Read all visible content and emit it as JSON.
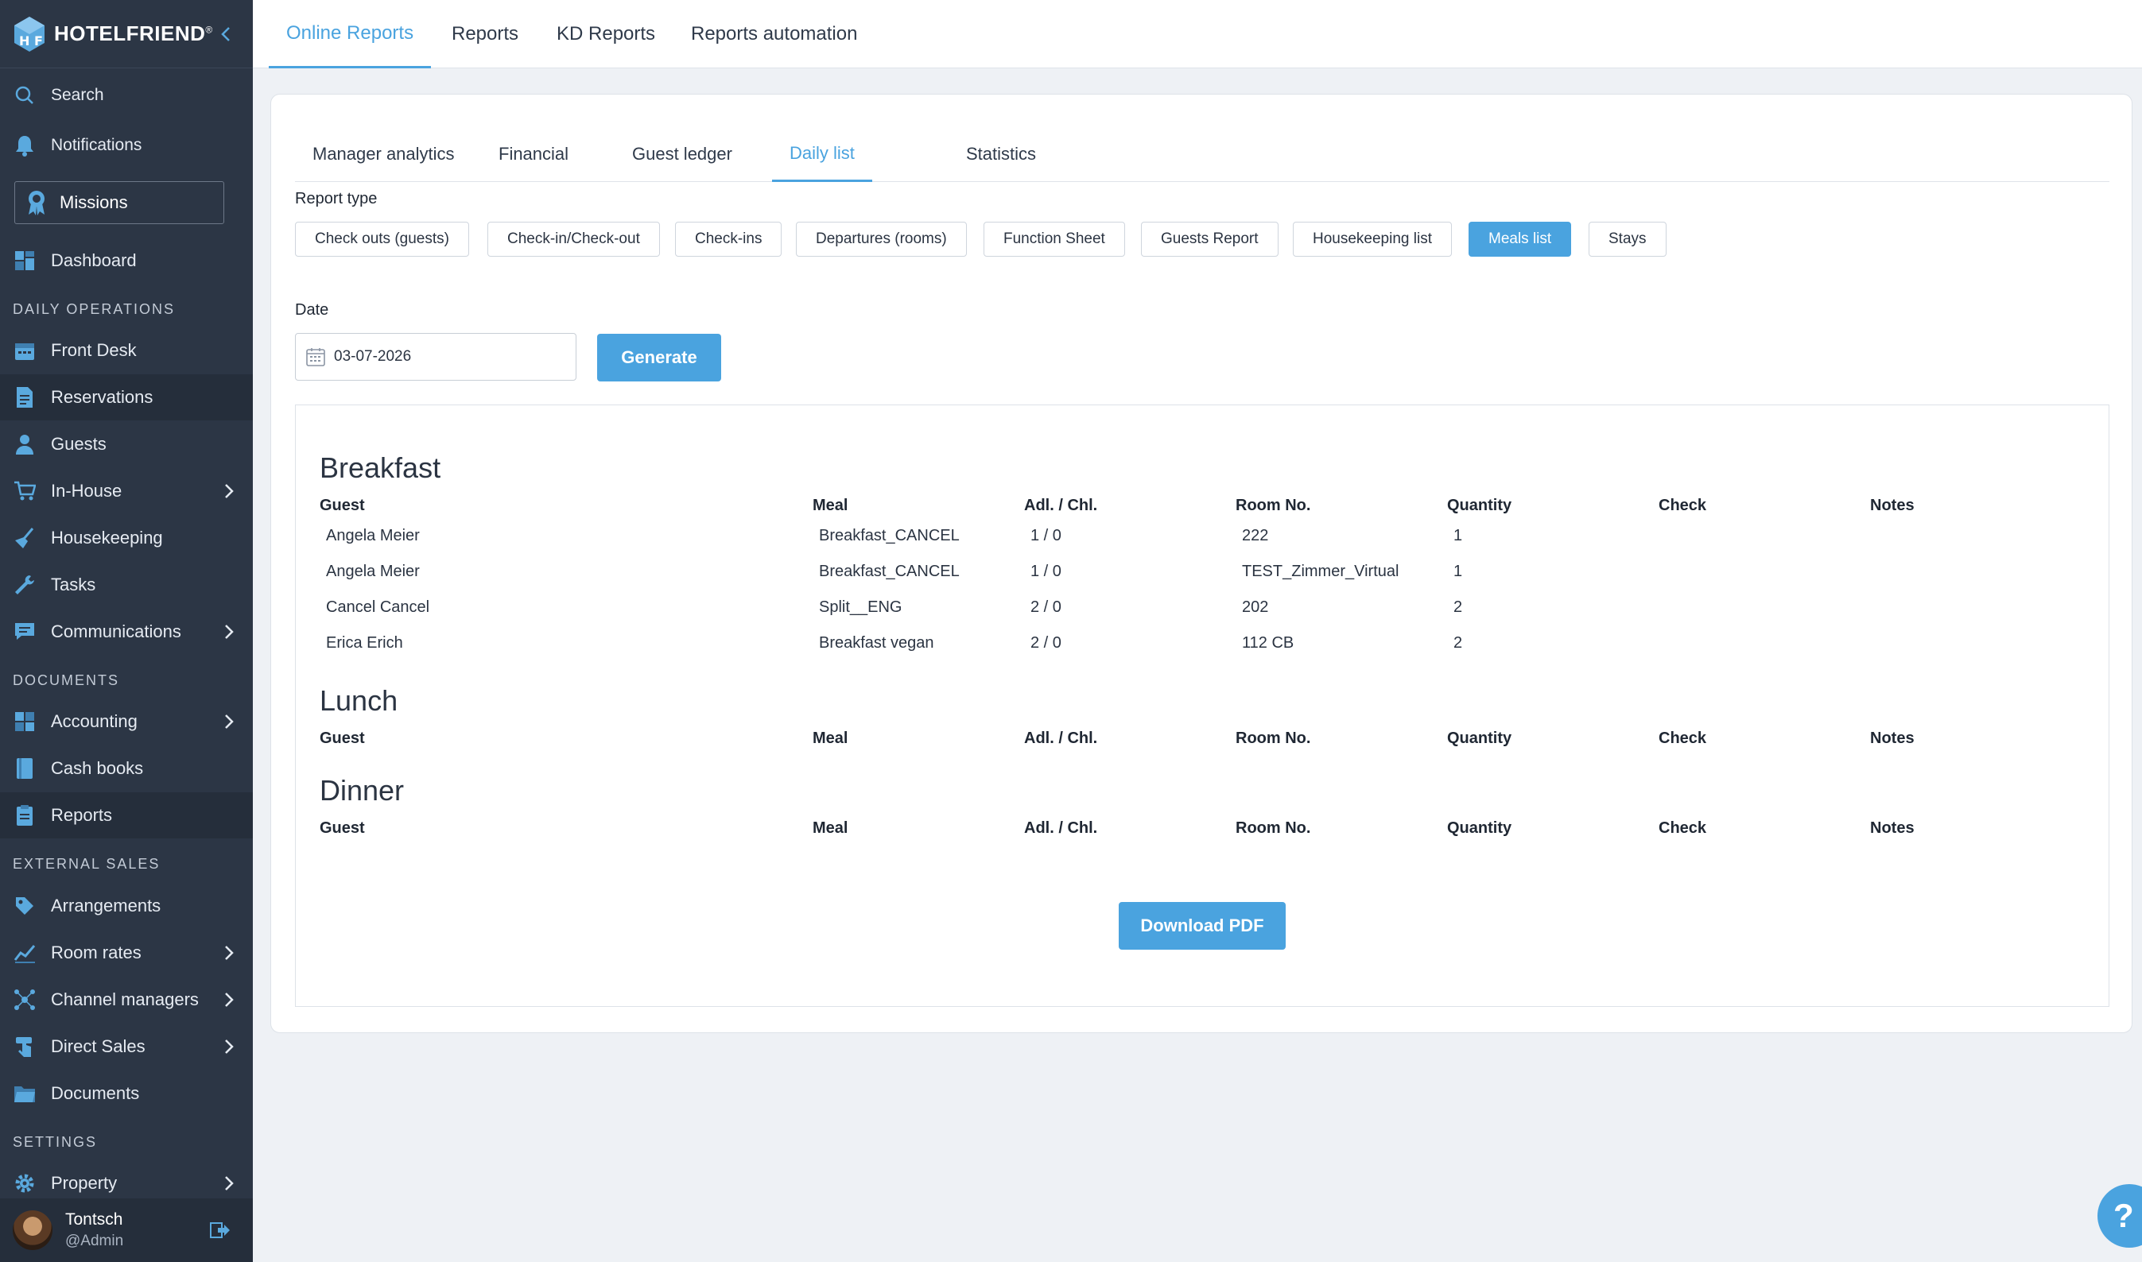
{
  "brand": {
    "name": "HOTELFRIEND",
    "registered": "®"
  },
  "sidebar": {
    "search": "Search",
    "notifications": "Notifications",
    "missions": "Missions",
    "dashboard": "Dashboard",
    "sections": {
      "daily_operations": "DAILY OPERATIONS",
      "documents": "DOCUMENTS",
      "external_sales": "EXTERNAL SALES",
      "settings": "SETTINGS"
    },
    "items": {
      "front_desk": "Front Desk",
      "reservations": "Reservations",
      "guests": "Guests",
      "in_house": "In-House",
      "housekeeping": "Housekeeping",
      "tasks": "Tasks",
      "communications": "Communications",
      "accounting": "Accounting",
      "cash_books": "Cash books",
      "reports": "Reports",
      "arrangements": "Arrangements",
      "room_rates": "Room rates",
      "channel_managers": "Channel managers",
      "direct_sales": "Direct Sales",
      "documents": "Documents",
      "property": "Property"
    },
    "user": {
      "name": "Tontsch",
      "role": "@Admin"
    }
  },
  "top_tabs": [
    "Online Reports",
    "Reports",
    "KD Reports",
    "Reports automation"
  ],
  "sub_tabs": [
    "Manager analytics",
    "Financial",
    "Guest ledger",
    "Daily list",
    "Statistics"
  ],
  "report_type": {
    "label": "Report type",
    "options": [
      "Check outs (guests)",
      "Check-in/Check-out",
      "Check-ins",
      "Departures (rooms)",
      "Function Sheet",
      "Guests Report",
      "Housekeeping list",
      "Meals list",
      "Stays"
    ],
    "selected": "Meals list"
  },
  "date": {
    "label": "Date",
    "value": "03-07-2026"
  },
  "generate_label": "Generate",
  "columns": [
    "Guest",
    "Meal",
    "Adl. / Chl.",
    "Room No.",
    "Quantity",
    "Check",
    "Notes"
  ],
  "meals": {
    "breakfast": {
      "title": "Breakfast",
      "rows": [
        [
          "Angela Meier",
          "Breakfast_CANCEL",
          "1 / 0",
          "222",
          "1"
        ],
        [
          "Angela Meier",
          "Breakfast_CANCEL",
          "1 / 0",
          "TEST_Zimmer_Virtual",
          "1"
        ],
        [
          "Cancel Cancel",
          "Split__ENG",
          "2 / 0",
          "202",
          "2"
        ],
        [
          "Erica Erich",
          "Breakfast vegan",
          "2 / 0",
          "112 CB",
          "2"
        ]
      ]
    },
    "lunch": {
      "title": "Lunch"
    },
    "dinner": {
      "title": "Dinner"
    }
  },
  "download_label": "Download PDF",
  "help_label": "?",
  "colors": {
    "accent": "#4aa3df",
    "sidebar_bg": "#2c3645",
    "page_bg": "#eef1f5"
  }
}
